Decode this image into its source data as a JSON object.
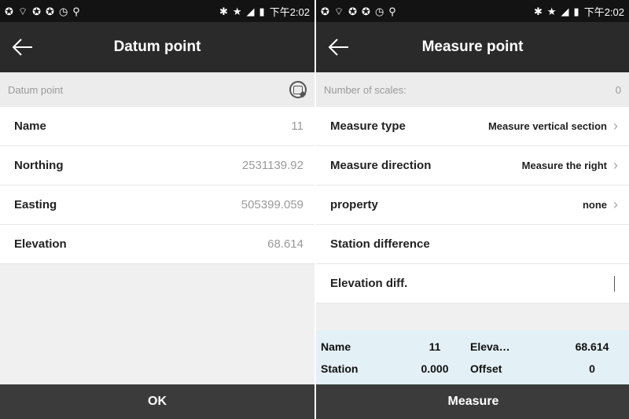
{
  "status": {
    "time": "下午2:02"
  },
  "left": {
    "title": "Datum point",
    "section_label": "Datum point",
    "fields": [
      {
        "label": "Name",
        "value": "11"
      },
      {
        "label": "Northing",
        "value": "2531139.92"
      },
      {
        "label": "Easting",
        "value": "505399.059"
      },
      {
        "label": "Elevation",
        "value": "68.614"
      }
    ],
    "ok_label": "OK"
  },
  "right": {
    "title": "Measure point",
    "scales_label": "Number of scales:",
    "scales_value": "0",
    "rows": [
      {
        "label": "Measure type",
        "value": "Measure vertical section"
      },
      {
        "label": "Measure direction",
        "value": "Measure the right"
      },
      {
        "label": "property",
        "value": "none"
      },
      {
        "label": "Station difference",
        "value": ""
      },
      {
        "label": "Elevation diff.",
        "value": ""
      }
    ],
    "info": {
      "name_label": "Name",
      "name_value": "11",
      "elev_label": "Eleva…",
      "elev_value": "68.614",
      "station_label": "Station",
      "station_value": "0.000",
      "offset_label": "Offset",
      "offset_value": "0"
    },
    "measure_label": "Measure"
  },
  "icons": [
    "back-arrow-icon",
    "capture-point-icon",
    "chevron-right-icon",
    "bluetooth-icon",
    "star-icon",
    "signal-icon",
    "battery-icon"
  ]
}
